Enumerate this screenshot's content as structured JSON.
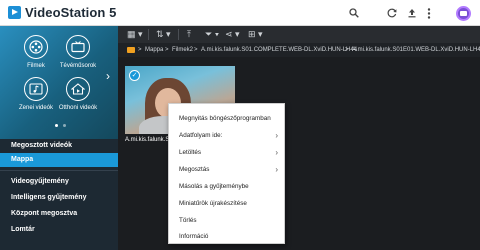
{
  "app": {
    "title": "VideoStation 5",
    "logo_icon": "play-logo-icon"
  },
  "header_icons": [
    "search-icon",
    "refresh-icon",
    "upload-icon",
    "more-vert-icon",
    "user-avatar-icon"
  ],
  "carousel": {
    "tiles": [
      {
        "label": "Filmek",
        "icon": "film-reel-icon"
      },
      {
        "label": "Tévéműsorok",
        "icon": "tv-icon"
      },
      {
        "label": "Zenei videók",
        "icon": "music-video-icon"
      },
      {
        "label": "Otthoni videók",
        "icon": "home-video-icon"
      }
    ],
    "page_count": 2,
    "active_page": 1
  },
  "sidebar": {
    "items": [
      {
        "label": "Megosztott videók",
        "selected": false
      },
      {
        "label": "Mappa",
        "selected": true
      },
      {
        "label": "Videogyűjtemény",
        "selected": false
      },
      {
        "label": "Intelligens gyűjtemény",
        "selected": false
      },
      {
        "label": "Központ megosztva",
        "selected": false
      },
      {
        "label": "Lomtár",
        "selected": false
      }
    ]
  },
  "toolbar": {
    "icons": [
      "grid-view-icon",
      "sort-icon",
      "upload-to-top-icon",
      "filter-icon",
      "share-icon",
      "select-all-icon"
    ]
  },
  "breadcrumb": {
    "folder_icon": "folder-icon",
    "parts": [
      "Mappa",
      "Filmek2",
      "A.mi.kis.falunk.S01.COMPLETE.WEB-DL.XviD.HUN-LH44",
      "A.mi.kis.falunk.S01E01.WEB-DL.XviD.HUN-LH44"
    ],
    "separator": ">"
  },
  "content": {
    "items": [
      {
        "title": "A.mi.kis.falunk.S01E01.WEB",
        "selected": true
      }
    ]
  },
  "context_menu": {
    "items": [
      {
        "label": "Megnyitás böngészőprogramban",
        "submenu": false
      },
      {
        "label": "Adatfolyam ide:",
        "submenu": true
      },
      {
        "label": "Letöltés",
        "submenu": true
      },
      {
        "label": "Megosztás",
        "submenu": true
      },
      {
        "label": "Másolás a gyűjteménybe",
        "submenu": false
      },
      {
        "label": "Miniatűrök újrakészítése",
        "submenu": false
      },
      {
        "label": "Törlés",
        "submenu": false
      },
      {
        "label": "Információ",
        "submenu": false
      }
    ]
  },
  "colors": {
    "accent": "#1a99d9",
    "sidebar_bg": "#1d2933",
    "content_bg": "#1b1d20",
    "folder": "#f0a020"
  }
}
